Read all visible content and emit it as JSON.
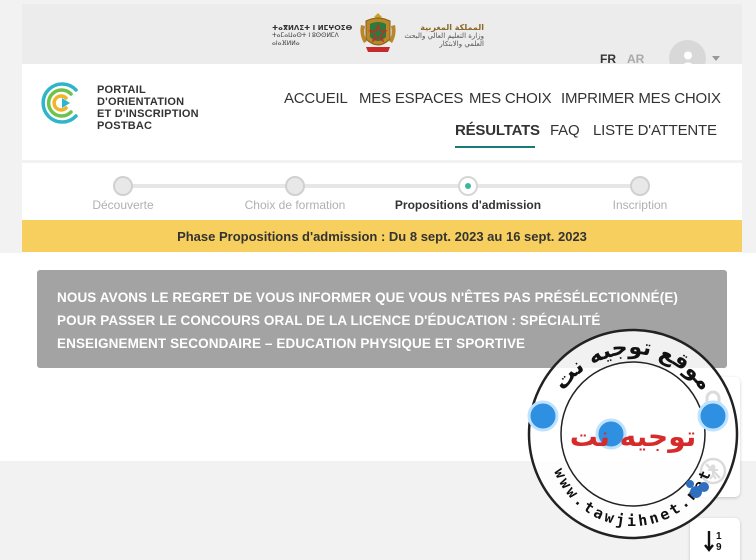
{
  "ministry": {
    "tifinagh_title": "ⵜⴰⴳⵍⴷⵉⵜ ⵏ ⵍⵎⵖⵔⵉⴱ",
    "tifinagh_sub": "ⵜⴰⵎⴰⵡⴰⵙⵜ ⵏ ⵓⵙⵙⵍⵎⴷ ⴰⵏⴰⴼⵍⵍⴰ",
    "arabic_title": "المملكة المغربية",
    "arabic_sub": "وزارة التعليم العالي والبحث العلمي والابتكار"
  },
  "lang": {
    "fr": "FR",
    "ar": "AR"
  },
  "logo": {
    "line1": "PORTAIL",
    "line2": "D'ORIENTATION",
    "line3": "ET D'INSCRIPTION",
    "line4": "POSTBAC"
  },
  "nav": {
    "accueil": "ACCUEIL",
    "espaces": "MES ESPACES",
    "choix": "MES CHOIX",
    "imprimer": "IMPRIMER MES CHOIX",
    "resultats": "RÉSULTATS",
    "faq": "FAQ",
    "attente": "LISTE D'ATTENTE"
  },
  "steps": [
    {
      "label": "Découverte",
      "state": "done"
    },
    {
      "label": "Choix de formation",
      "state": "done"
    },
    {
      "label": "Propositions d'admission",
      "state": "active"
    },
    {
      "label": "Inscription",
      "state": "pending"
    }
  ],
  "phase": "Phase Propositions d'admission : Du 8 sept. 2023 au 16 sept. 2023",
  "message": {
    "line1": "NOUS AVONS LE REGRET DE VOUS INFORMER QUE VOUS N'ÊTES PAS PRÉSÉLECTIONNÉ(E)",
    "line2": "POUR PASSER LE CONCOURS ORAL DE LA LICENCE D'ÉDUCATION : SPÉCIALITÉ",
    "line3": "ENSEIGNEMENT SECONDAIRE – EDUCATION PHYSIQUE ET SPORTIVE"
  },
  "watermark": {
    "brand": "توجيه نت",
    "arc_top": "موقع توجيه نت",
    "arc_bottom": "www.tawjihnet.net",
    "badge": "tawjihnet"
  },
  "icons": {
    "avatar": "user-icon",
    "lock": "lock-icon",
    "accessibility": "accessibility-icon",
    "sort": "sort-numeric-icon"
  },
  "colors": {
    "accent": "#1a7a7a",
    "active_dot": "#3bb89e",
    "phase_bg": "#f7cf5e",
    "message_bg": "#a3a3a3",
    "brand_red": "#d62b2b"
  }
}
